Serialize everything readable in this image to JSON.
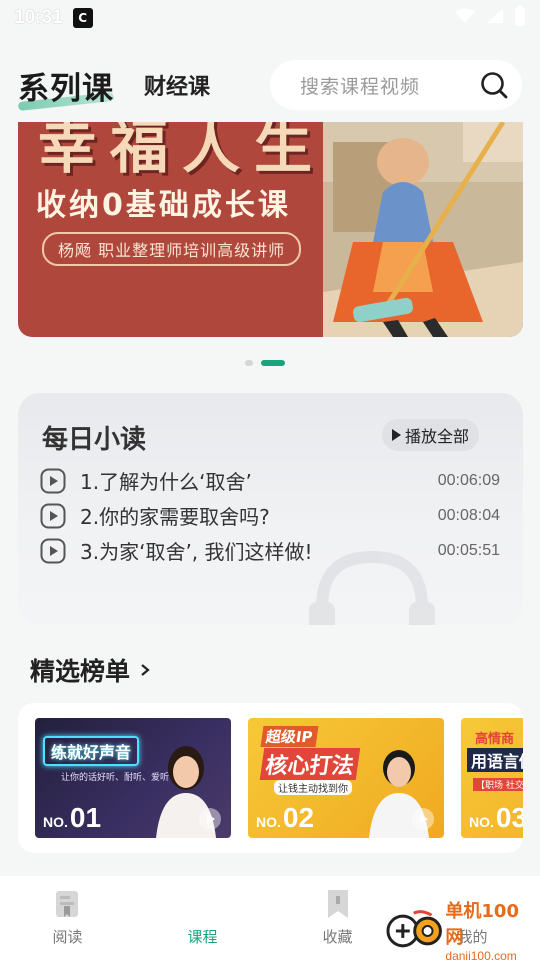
{
  "status_bar": {
    "time": "10:31"
  },
  "header": {
    "tab_active": "系列课",
    "tab_inactive": "财经课",
    "search_placeholder": "搜索课程视频"
  },
  "banner": {
    "title": "幸福人生",
    "subtitle": "收纳0基础成长课",
    "author": "杨飏  职业整理师培训高级讲师"
  },
  "carousel": {
    "count": 2,
    "active_index": 1
  },
  "daily": {
    "title": "每日小读",
    "play_all_label": "播放全部",
    "items": [
      {
        "text": "1.了解为什么‘取舍’",
        "duration": "00:06:09"
      },
      {
        "text": "2.你的家需要取舍吗?",
        "duration": "00:08:04"
      },
      {
        "text": "3.为家‘取舍’, 我们这样做!",
        "duration": "00:05:51"
      }
    ]
  },
  "rank": {
    "title": "精选榜单",
    "cards": [
      {
        "no_label": "NO.",
        "no": "01",
        "title": "练就好声音",
        "subtitle": "让你的话好听、耐听、爱听"
      },
      {
        "no_label": "NO.",
        "no": "02",
        "tag": "超级IP",
        "title": "核心打法",
        "subtitle": "让钱主动找到你"
      },
      {
        "no_label": "NO.",
        "no": "03",
        "tag": "高情商",
        "title": "用语言做",
        "subtitle": "【职场 社交"
      }
    ]
  },
  "bottom_nav": {
    "items": [
      {
        "label": "阅读",
        "active": false
      },
      {
        "label": "课程",
        "active": true
      },
      {
        "label": "收藏",
        "active": false
      },
      {
        "label": "我的",
        "active": false
      }
    ]
  },
  "watermark": {
    "main": "单机100网",
    "url": "danji100.com"
  },
  "colors": {
    "accent": "#1aa47e",
    "banner_bg": "#b0473d"
  }
}
